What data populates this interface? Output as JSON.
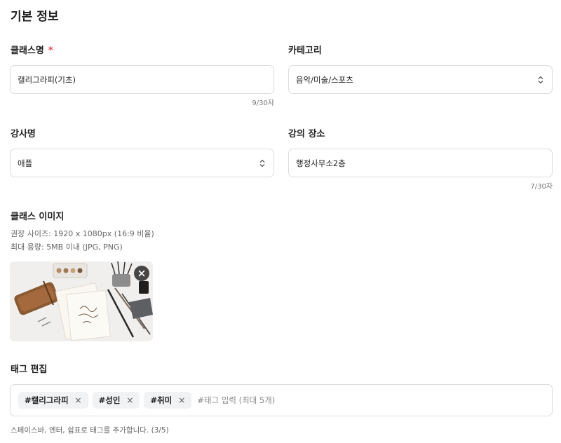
{
  "section": {
    "title": "기본 정보"
  },
  "class_name": {
    "label": "클래스명",
    "required_mark": "*",
    "value": "캘리그라피(기초)",
    "counter": "9/30자"
  },
  "category": {
    "label": "카테고리",
    "value": "음악/미술/스포츠"
  },
  "instructor": {
    "label": "강사명",
    "value": "애플"
  },
  "location": {
    "label": "강의 장소",
    "value": "행정사무소2층",
    "counter": "7/30자"
  },
  "class_image": {
    "label": "클래스 이미지",
    "hint_size": "권장 사이즈: 1920 x 1080px (16:9 비율)",
    "hint_capacity": "최대 용량: 5MB 이내 (JPG, PNG)",
    "remove_icon": "close-icon",
    "image_content": "calligraphy-supplies-photo"
  },
  "tags": {
    "label": "태그 편집",
    "items": [
      {
        "text": "#캘리그라피"
      },
      {
        "text": "#성인"
      },
      {
        "text": "#취미"
      }
    ],
    "remove_glyph": "×",
    "input_placeholder": "#태그 입력 (최대 5개)",
    "help": "스페이스바, 엔터, 쉼표로 태그를 추가합니다. (3/5)"
  },
  "colors": {
    "required": "#e5484d",
    "border": "#dcdcdc",
    "tag_bg": "#f1f2f4"
  }
}
